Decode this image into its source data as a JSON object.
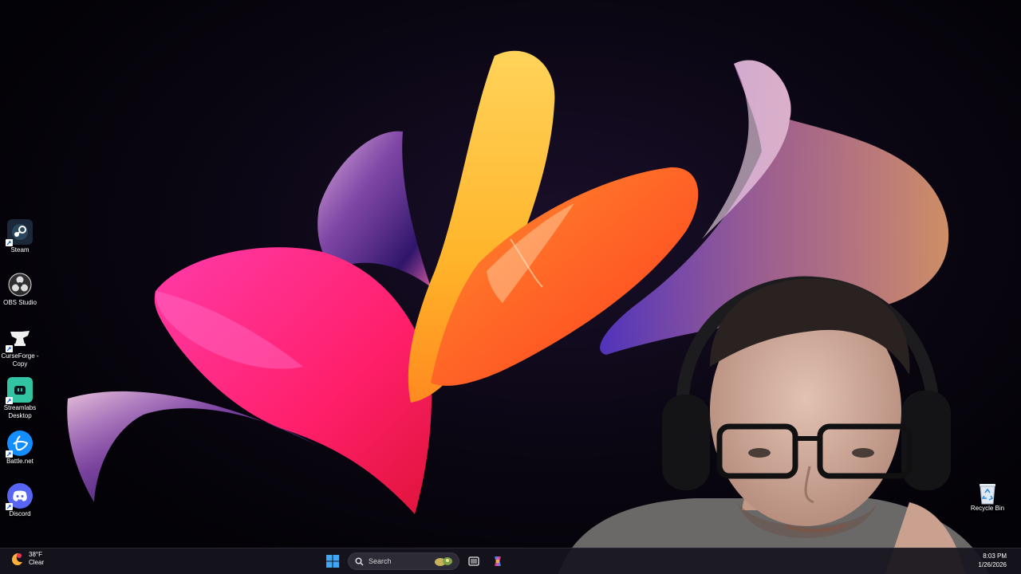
{
  "desktop_icons": [
    {
      "name": "steam",
      "label": "Steam",
      "icon": "steam-icon",
      "color": "#1b2838"
    },
    {
      "name": "obs-studio",
      "label": "OBS Studio",
      "icon": "obs-icon",
      "color": "#302e31"
    },
    {
      "name": "curseforge-copy",
      "label": "CurseForge - Copy",
      "icon": "curseforge-icon",
      "color": "#111111"
    },
    {
      "name": "streamlabs-desktop",
      "label": "Streamlabs Desktop",
      "icon": "streamlabs-icon",
      "color": "#31c3a2"
    },
    {
      "name": "battle-net",
      "label": "Battle.net",
      "icon": "battlenet-icon",
      "color": "#148eff"
    },
    {
      "name": "discord",
      "label": "Discord",
      "icon": "discord-icon",
      "color": "#5865f2"
    }
  ],
  "recycle_bin": {
    "label": "Recycle Bin",
    "icon": "recycle-bin-icon"
  },
  "taskbar": {
    "weather": {
      "temperature": "38°F",
      "condition": "Clear",
      "icon": "weather-moon-icon"
    },
    "search_placeholder": "Search",
    "clock": {
      "time": "8:03 PM",
      "date": "1/26/2026"
    }
  },
  "colors": {
    "taskbar_bg": "#16141c",
    "start_blue": "#3fa7f5"
  }
}
